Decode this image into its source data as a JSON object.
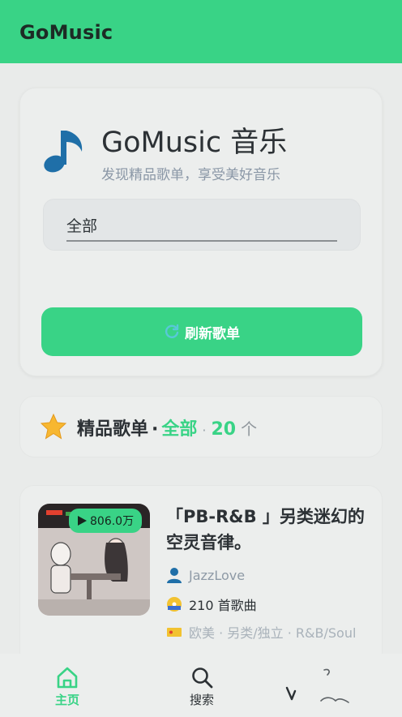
{
  "appbar": {
    "title": "GoMusic"
  },
  "hero": {
    "title": "GoMusic 音乐",
    "subtitle": "发现精品歌单，享受美好音乐",
    "icon": "music-note-icon"
  },
  "filter": {
    "selected": "全部"
  },
  "refresh_button": {
    "label": "刷新歌单",
    "icon": "refresh-icon"
  },
  "section": {
    "title": "精品歌单",
    "dot": "·",
    "category": "全部",
    "dot2": "·",
    "count": "20",
    "unit": "个",
    "icon": "star-icon"
  },
  "playlist": {
    "play_count": "806.0万",
    "title": "「PB-R&B 」另类迷幻的空灵音律。",
    "author": "JazzLove",
    "track_count": "210 首歌曲",
    "tags": "欧美 · 另类/独立 · R&B/Soul"
  },
  "bottom_nav": {
    "items": [
      {
        "label": "主页",
        "icon": "home-icon",
        "active": true
      },
      {
        "label": "搜索",
        "icon": "search-icon",
        "active": false
      }
    ]
  },
  "colors": {
    "accent": "#39d386",
    "background": "#e9ebea",
    "card": "#eceeed",
    "note_blue": "#1f6fa8"
  }
}
